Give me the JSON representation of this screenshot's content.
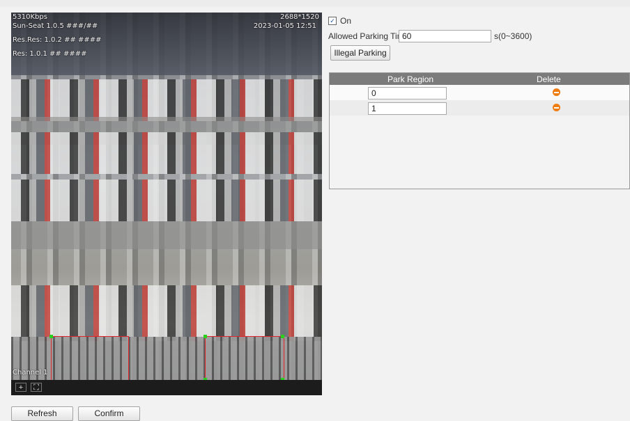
{
  "video": {
    "bitrate": "5310Kbps",
    "resolution": "2688*1520",
    "overlay_left_1": "Sun-Seat 1.0.5 ###/##",
    "overlay_left_2": "Res.Res: 1.0.2 ## ####",
    "overlay_left_3": "Res: 1.0.1 ## ####",
    "overlay_right": "2023-01-05 12:51",
    "channel": "Channel 1",
    "controls": [
      "zoom-icon",
      "fullscreen-icon"
    ]
  },
  "enable": {
    "checked": true,
    "label": "On"
  },
  "allowed_parking_time": {
    "label": "Allowed Parking Time",
    "value": "60",
    "range": "s(0~3600)"
  },
  "illegal_parking_button": "Illegal Parking",
  "table": {
    "headers": [
      "Park Region",
      "Delete"
    ],
    "rows": [
      {
        "region": "0"
      },
      {
        "region": "1"
      }
    ]
  },
  "buttons": {
    "refresh": "Refresh",
    "confirm": "Confirm"
  },
  "colors": {
    "region_outline": "#e0242a",
    "handle": "#2bd01e",
    "delete": "#f07d12",
    "header": "#7b7b7b"
  }
}
